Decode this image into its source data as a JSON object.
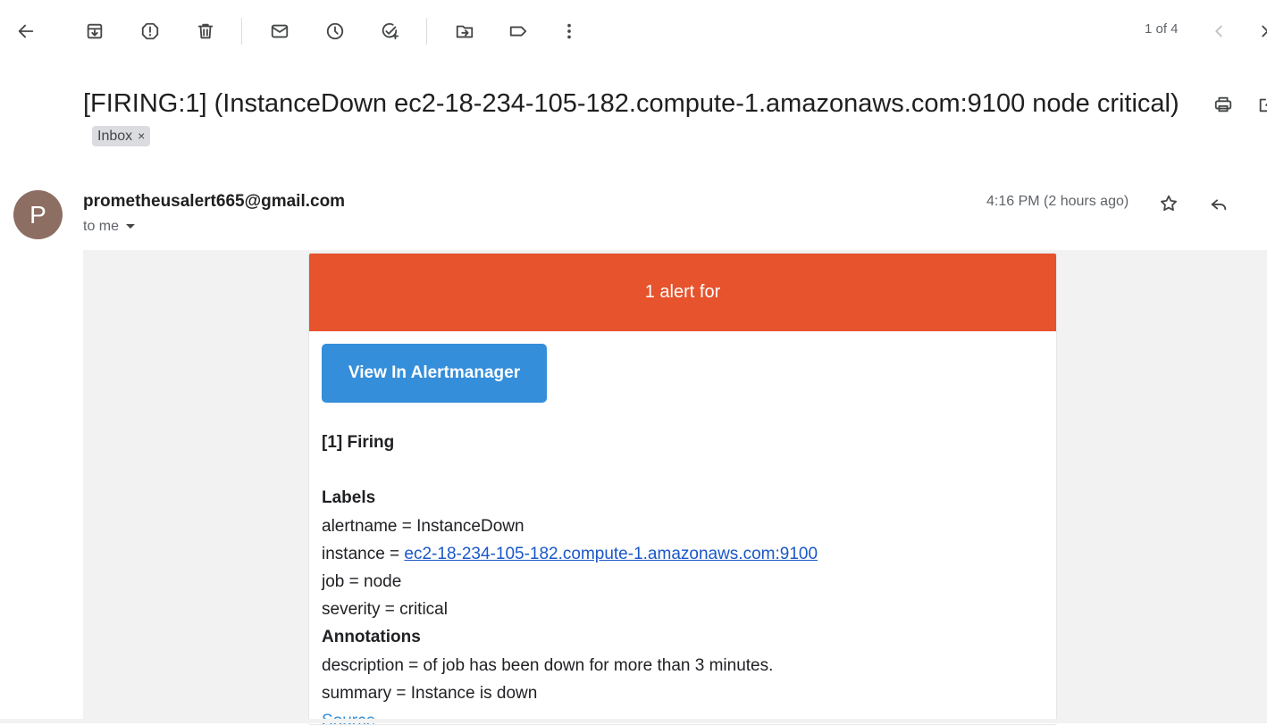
{
  "toolbar": {
    "back": "arrow-left-icon",
    "archive": "archive-icon",
    "spam": "report-spam-icon",
    "delete": "trash-icon",
    "unread": "mail-icon",
    "snooze": "clock-icon",
    "task": "add-task-icon",
    "move": "move-to-folder-icon",
    "label": "label-icon",
    "more": "more-vert-icon",
    "pager_text": "1 of 4"
  },
  "email": {
    "subject": "[FIRING:1] (InstanceDown ec2-18-234-105-182.compute-1.amazonaws.com:9100 node critical)",
    "label_chip": "Inbox",
    "chip_close": "×",
    "avatar_letter": "P",
    "sender": "prometheusalert665@gmail.com",
    "to": "to me",
    "time": "4:16 PM (2 hours ago)"
  },
  "alert": {
    "banner": "1 alert for",
    "button": "View In Alertmanager",
    "firing": "[1] Firing",
    "labels_heading": "Labels",
    "alertname": "alertname = InstanceDown",
    "instance_prefix": "instance = ",
    "instance_link": "ec2-18-234-105-182.compute-1.amazonaws.com:9100",
    "job": "job = node",
    "severity": "severity = critical",
    "annotations_heading": "Annotations",
    "description": "description = of job has been down for more than 3 minutes.",
    "summary": "summary = Instance is down",
    "source": "Source"
  },
  "colors": {
    "banner": "#e6532d",
    "button": "#348eda",
    "link": "#1a57c8",
    "avatar": "#8d6e63"
  }
}
